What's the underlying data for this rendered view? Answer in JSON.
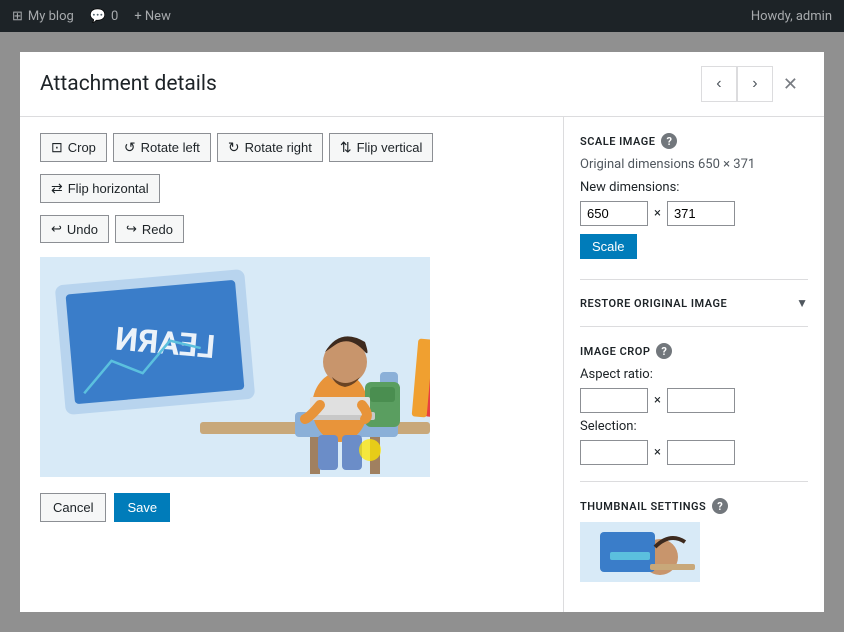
{
  "adminBar": {
    "blogLabel": "My blog",
    "commentIcon": "💬",
    "commentCount": "0",
    "newLabel": "+ New",
    "howdy": "Howdy, admin"
  },
  "modal": {
    "title": "Attachment details",
    "prevTitle": "Previous",
    "nextTitle": "Next",
    "closeTitle": "Close"
  },
  "toolbar": {
    "cropLabel": "Crop",
    "rotateLeftLabel": "Rotate left",
    "rotateRightLabel": "Rotate right",
    "flipVerticalLabel": "Flip vertical",
    "flipHorizontalLabel": "Flip horizontal",
    "undoLabel": "Undo",
    "redoLabel": "Redo"
  },
  "actions": {
    "cancelLabel": "Cancel",
    "saveLabel": "Save"
  },
  "rightPanel": {
    "scaleImageTitle": "SCALE IMAGE",
    "originalDims": "Original dimensions 650 × 371",
    "newDimsLabel": "New dimensions:",
    "widthValue": "650",
    "heightValue": "371",
    "scaleLabel": "Scale",
    "restoreLabel": "RESTORE ORIGINAL IMAGE",
    "imageCropTitle": "IMAGE CROP",
    "aspectRatioLabel": "Aspect ratio:",
    "selectionLabel": "Selection:",
    "thumbnailTitle": "THUMBNAIL SETTINGS"
  }
}
